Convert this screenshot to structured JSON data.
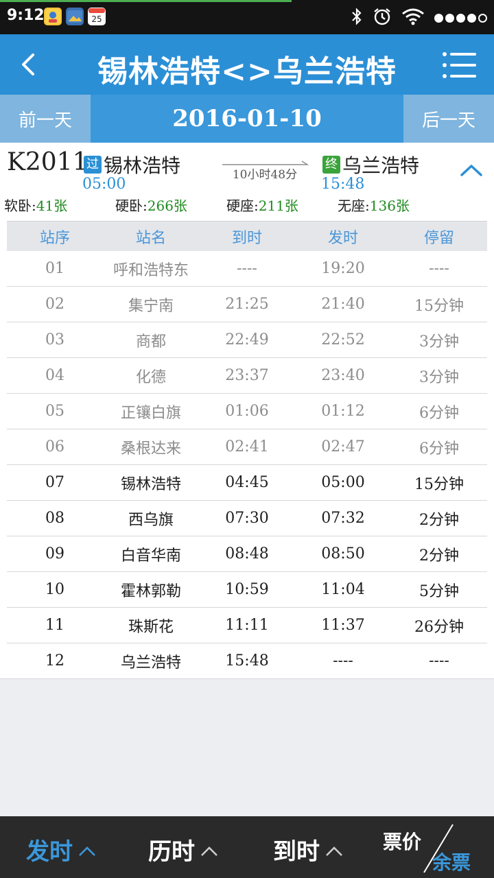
{
  "status_bar": {
    "time": "9:12",
    "calendar_day": "25",
    "progress": 0.59,
    "icons": [
      "contacts-app-icon",
      "photo-app-icon",
      "calendar-app-icon",
      "bluetooth-icon",
      "alarm-icon",
      "wifi-icon",
      "signal-icon"
    ]
  },
  "header": {
    "title": "锡林浩特<>乌兰浩特",
    "back_icon": "chevron-left-icon",
    "menu_icon": "menu-icon"
  },
  "date_bar": {
    "prev_label": "前一天",
    "date": "2016-01-10",
    "next_label": "后一天"
  },
  "train": {
    "number": "K2011",
    "from_badge": "过",
    "from_station": "锡林浩特",
    "from_time": "05:00",
    "duration": "10小时48分",
    "to_badge": "终",
    "to_station": "乌兰浩特",
    "to_time": "15:48",
    "seats": [
      {
        "label": "软卧:",
        "count": "41张"
      },
      {
        "label": "硬卧:",
        "count": "266张"
      },
      {
        "label": "硬座:",
        "count": "211张"
      },
      {
        "label": "无座:",
        "count": "136张"
      }
    ]
  },
  "table": {
    "headers": [
      "站序",
      "站名",
      "到时",
      "发时",
      "停留"
    ],
    "rows": [
      [
        "01",
        "呼和浩特东",
        "----",
        "19:20",
        "----"
      ],
      [
        "02",
        "集宁南",
        "21:25",
        "21:40",
        "15分钟"
      ],
      [
        "03",
        "商都",
        "22:49",
        "22:52",
        "3分钟"
      ],
      [
        "04",
        "化德",
        "23:37",
        "23:40",
        "3分钟"
      ],
      [
        "05",
        "正镶白旗",
        "01:06",
        "01:12",
        "6分钟"
      ],
      [
        "06",
        "桑根达来",
        "02:41",
        "02:47",
        "6分钟"
      ],
      [
        "07",
        "锡林浩特",
        "04:45",
        "05:00",
        "15分钟"
      ],
      [
        "08",
        "西乌旗",
        "07:30",
        "07:32",
        "2分钟"
      ],
      [
        "09",
        "白音华南",
        "08:48",
        "08:50",
        "2分钟"
      ],
      [
        "10",
        "霍林郭勒",
        "10:59",
        "11:04",
        "5分钟"
      ],
      [
        "11",
        "珠斯花",
        "11:11",
        "11:37",
        "26分钟"
      ],
      [
        "12",
        "乌兰浩特",
        "15:48",
        "----",
        "----"
      ]
    ]
  },
  "bottom_bar": {
    "sort_depart": "发时",
    "sort_duration": "历时",
    "sort_arrive": "到时",
    "price_label": "票价",
    "remaining_label": "余票"
  },
  "colors": {
    "accent": "#2b8fd6",
    "seat_count": "#1e8a1e",
    "past_row": "#8c8c8c"
  }
}
